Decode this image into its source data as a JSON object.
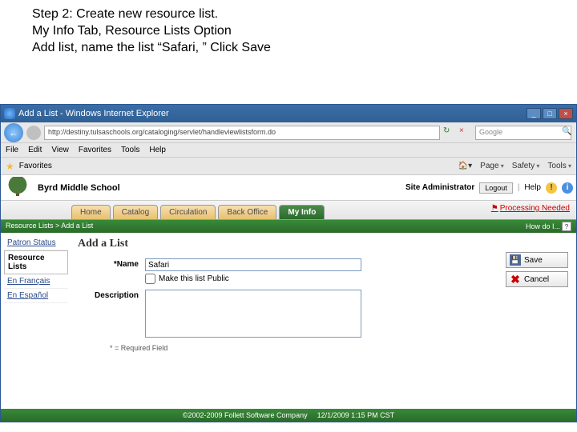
{
  "instruction": {
    "line1": "Step 2: Create new resource list.",
    "line2": "My Info Tab, Resource Lists Option",
    "line3": "Add list, name the list “Safari, ” Click Save"
  },
  "browser": {
    "title": "Add a List - Windows Internet Explorer",
    "url": "http://destiny.tulsaschools.org/cataloging/servlet/handleviewlistsform.do",
    "search_engine": "Google",
    "menu": [
      "File",
      "Edit",
      "View",
      "Favorites",
      "Tools",
      "Help"
    ],
    "favorites_label": "Favorites",
    "toolbar_right": [
      "Page",
      "Safety",
      "Tools"
    ],
    "win_min": "_",
    "win_max": "□",
    "win_close": "×"
  },
  "destiny": {
    "school": "Byrd Middle School",
    "role": "Site Administrator",
    "logout": "Logout",
    "help": "Help",
    "tabs": [
      "Home",
      "Catalog",
      "Circulation",
      "Back Office",
      "My Info"
    ],
    "active_tab": "My Info",
    "processing": "Processing Needed",
    "breadcrumb": "Resource Lists > Add a List",
    "howdo": "How do I...",
    "q": "?"
  },
  "sidebar": {
    "items": [
      {
        "label": "Patron Status"
      },
      {
        "label": "Resource Lists"
      },
      {
        "label": "En Français"
      },
      {
        "label": "En Español"
      }
    ]
  },
  "form": {
    "heading": "Add a List",
    "name_label": "*Name",
    "name_value": "Safari",
    "public_label": "Make this list Public",
    "desc_label": "Description",
    "required_note": "* = Required Field",
    "save": "Save",
    "cancel": "Cancel"
  },
  "footer": {
    "copyright": "©2002-2009 Follett Software Company",
    "timestamp": "12/1/2009 1:15 PM CST"
  }
}
